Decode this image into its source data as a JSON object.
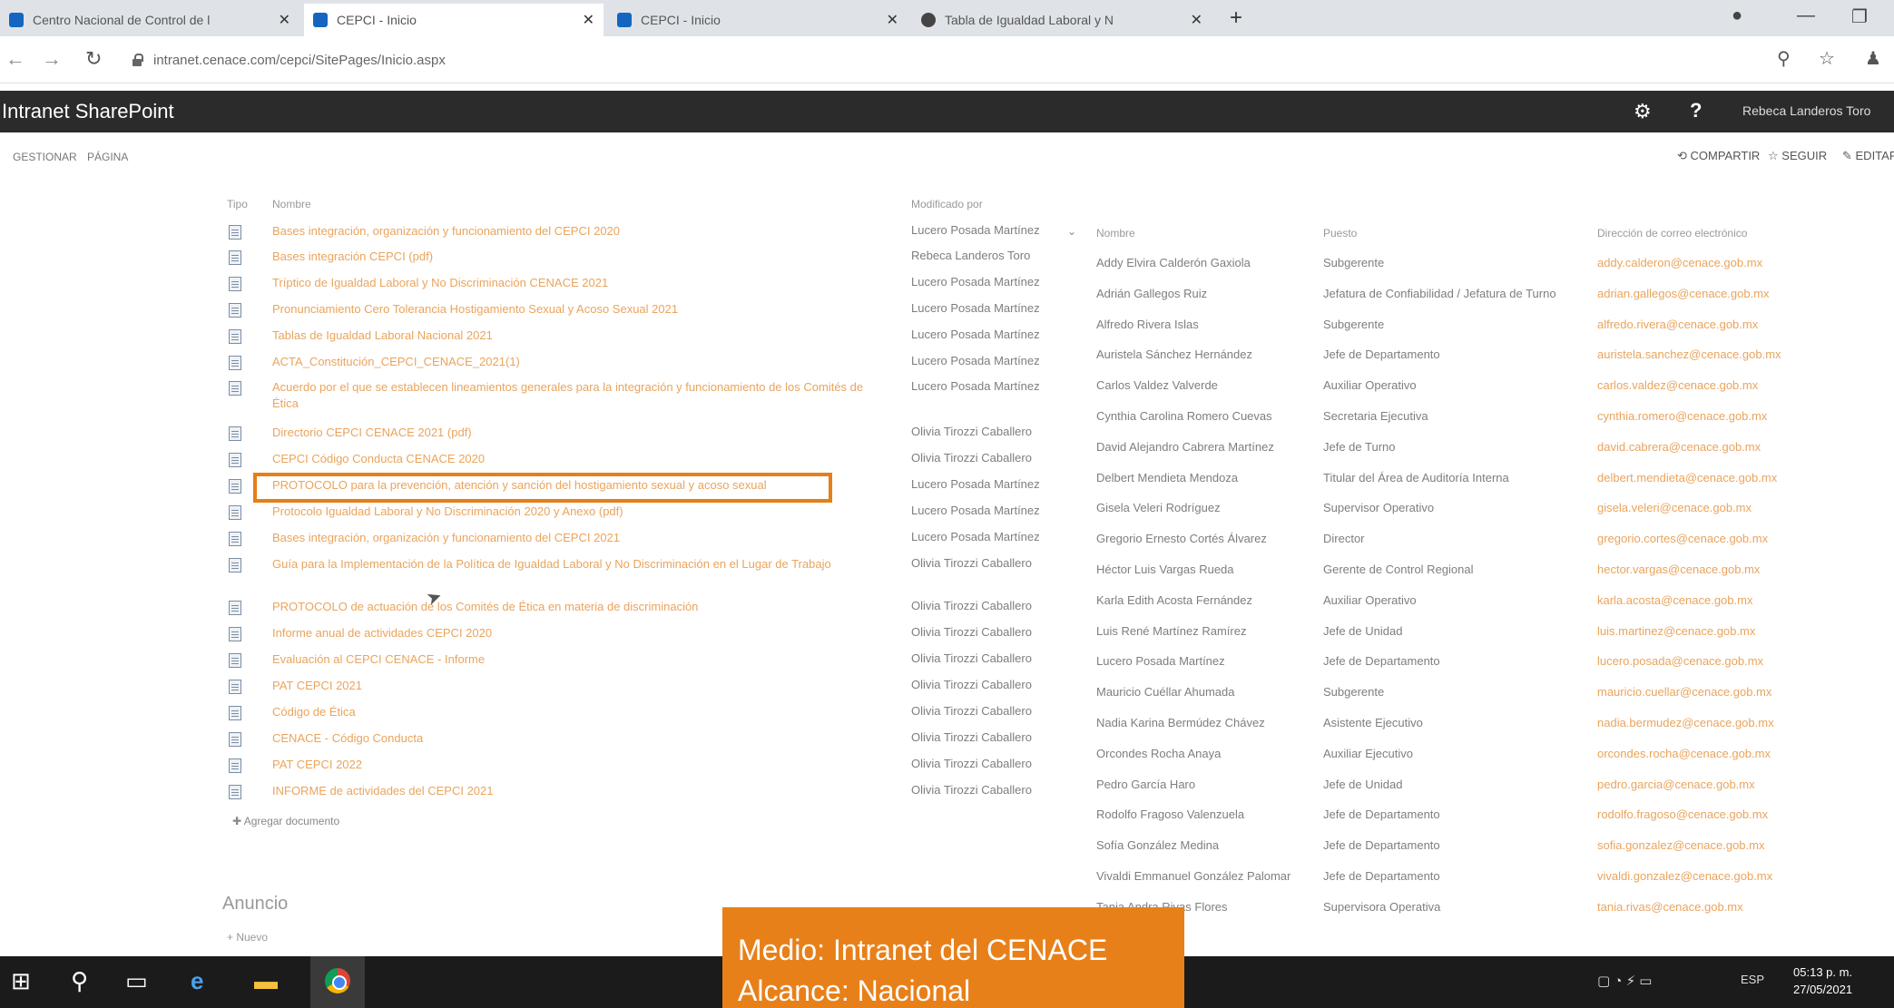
{
  "browser": {
    "tabs": [
      {
        "label": "Centro Nacional de Control de l",
        "active": false
      },
      {
        "label": "CEPCI - Inicio",
        "active": true
      },
      {
        "label": "CEPCI - Inicio",
        "active": false
      },
      {
        "label": "Tabla de Igualdad Laboral y N",
        "active": false
      }
    ],
    "new_tab": "+",
    "url": "intranet.cenace.com/cepci/SitePages/Inicio.aspx",
    "icons": {
      "back": "back-arrow-icon",
      "forward": "forward-arrow-icon",
      "reload": "reload-icon",
      "zoom": "zoom-icon",
      "star": "star-icon",
      "account": "account-icon"
    }
  },
  "suite": {
    "brand": "Intranet SharePoint",
    "help": "?",
    "user": "Rebeca Landeros Toro"
  },
  "ribbon": {
    "tabs": [
      "GESTIONAR",
      "PÁGINA"
    ],
    "actions": [
      "COMPARTIR",
      "SEGUIR",
      "EDITAR"
    ]
  },
  "documents": {
    "col_type": "Tipo",
    "col_name": "Nombre",
    "col_modified": "Modificado por",
    "add_link": "Agregar documento",
    "rows": [
      {
        "name": "Bases integración, organización y funcionamiento del CEPCI 2020",
        "modified_by": "Lucero Posada Martínez"
      },
      {
        "name": "Bases integración CEPCI (pdf)",
        "modified_by": "Rebeca Landeros Toro"
      },
      {
        "name": "Tríptico de Igualdad Laboral y No Discriminación CENACE 2021",
        "modified_by": "Lucero Posada Martínez"
      },
      {
        "name": "Pronunciamiento Cero Tolerancia Hostigamiento Sexual y Acoso Sexual 2021",
        "modified_by": "Lucero Posada Martínez"
      },
      {
        "name": "Tablas de Igualdad Laboral Nacional 2021",
        "modified_by": "Lucero Posada Martínez"
      },
      {
        "name": "ACTA_Constitución_CEPCI_CENACE_2021(1)",
        "modified_by": "Lucero Posada Martínez"
      },
      {
        "name": "Acuerdo por el que se establecen lineamientos generales para la integración y funcionamiento de los Comités de Ética",
        "modified_by": "Lucero Posada Martínez"
      },
      {
        "name": "Directorio CEPCI CENACE 2021 (pdf)",
        "modified_by": "Olivia Tirozzi Caballero"
      },
      {
        "name": "CEPCI Código Conducta CENACE 2020",
        "modified_by": "Olivia Tirozzi Caballero"
      },
      {
        "name": "PROTOCOLO para la prevención, atención y sanción del hostigamiento sexual y acoso sexual",
        "modified_by": "Lucero Posada Martínez"
      },
      {
        "name": "Protocolo Igualdad Laboral y No Discriminación 2020 y Anexo (pdf)",
        "modified_by": "Lucero Posada Martínez"
      },
      {
        "name": "Bases integración, organización y funcionamiento del CEPCI 2021",
        "modified_by": "Lucero Posada Martínez"
      },
      {
        "name": "Guía para la Implementación de la Política de Igualdad Laboral y No Discriminación en el Lugar de Trabajo",
        "modified_by": "Olivia Tirozzi Caballero"
      },
      {
        "name": "PROTOCOLO de actuación de los Comités de Ética en materia de discriminación",
        "modified_by": "Olivia Tirozzi Caballero"
      },
      {
        "name": "Informe anual de actividades CEPCI 2020",
        "modified_by": "Olivia Tirozzi Caballero"
      },
      {
        "name": "Evaluación al CEPCI CENACE - Informe",
        "modified_by": "Olivia Tirozzi Caballero"
      },
      {
        "name": "PAT CEPCI 2021",
        "modified_by": "Olivia Tirozzi Caballero"
      },
      {
        "name": "Código de Ética",
        "modified_by": "Olivia Tirozzi Caballero"
      },
      {
        "name": "CENACE - Código Conducta",
        "modified_by": "Olivia Tirozzi Caballero"
      },
      {
        "name": "PAT CEPCI 2022",
        "modified_by": "Olivia Tirozzi Caballero"
      },
      {
        "name": "INFORME de actividades del CEPCI 2021",
        "modified_by": "Olivia Tirozzi Caballero"
      }
    ]
  },
  "staff": {
    "col_name": "Nombre",
    "col_role": "Puesto",
    "col_mail": "Dirección de correo electrónico",
    "rows": [
      {
        "name": "Addy Elvira Calderón Gaxiola",
        "role": "Subgerente",
        "mail": "addy.calderon@cenace.gob.mx"
      },
      {
        "name": "Adrián Gallegos Ruiz",
        "role": "Jefatura de Confiabilidad / Jefatura de Turno",
        "mail": "adrian.gallegos@cenace.gob.mx"
      },
      {
        "name": "Alfredo Rivera Islas",
        "role": "Subgerente",
        "mail": "alfredo.rivera@cenace.gob.mx"
      },
      {
        "name": "Auristela Sánchez Hernández",
        "role": "Jefe de Departamento",
        "mail": "auristela.sanchez@cenace.gob.mx"
      },
      {
        "name": "Carlos Valdez Valverde",
        "role": "Auxiliar Operativo",
        "mail": "carlos.valdez@cenace.gob.mx"
      },
      {
        "name": "Cynthia Carolina Romero Cuevas",
        "role": "Secretaria Ejecutiva",
        "mail": "cynthia.romero@cenace.gob.mx"
      },
      {
        "name": "David Alejandro Cabrera Martínez",
        "role": "Jefe de Turno",
        "mail": "david.cabrera@cenace.gob.mx"
      },
      {
        "name": "Delbert Mendieta Mendoza",
        "role": "Titular del Área de Auditoría Interna",
        "mail": "delbert.mendieta@cenace.gob.mx"
      },
      {
        "name": "Gisela Veleri Rodríguez",
        "role": "Supervisor Operativo",
        "mail": "gisela.veleri@cenace.gob.mx"
      },
      {
        "name": "Gregorio Ernesto Cortés Álvarez",
        "role": "Director",
        "mail": "gregorio.cortes@cenace.gob.mx"
      },
      {
        "name": "Héctor Luis Vargas Rueda",
        "role": "Gerente de Control Regional",
        "mail": "hector.vargas@cenace.gob.mx"
      },
      {
        "name": "Karla Edith Acosta Fernández",
        "role": "Auxiliar Operativo",
        "mail": "karla.acosta@cenace.gob.mx"
      },
      {
        "name": "Luis René Martínez Ramírez",
        "role": "Jefe de Unidad",
        "mail": "luis.martinez@cenace.gob.mx"
      },
      {
        "name": "Lucero Posada Martínez",
        "role": "Jefe de Departamento",
        "mail": "lucero.posada@cenace.gob.mx"
      },
      {
        "name": "Mauricio Cuéllar Ahumada",
        "role": "Subgerente",
        "mail": "mauricio.cuellar@cenace.gob.mx"
      },
      {
        "name": "Nadia Karina Bermúdez Chávez",
        "role": "Asistente Ejecutivo",
        "mail": "nadia.bermudez@cenace.gob.mx"
      },
      {
        "name": "Orcondes Rocha Anaya",
        "role": "Auxiliar Ejecutivo",
        "mail": "orcondes.rocha@cenace.gob.mx"
      },
      {
        "name": "Pedro García Haro",
        "role": "Jefe de Unidad",
        "mail": "pedro.garcia@cenace.gob.mx"
      },
      {
        "name": "Rodolfo Fragoso Valenzuela",
        "role": "Jefe de Departamento",
        "mail": "rodolfo.fragoso@cenace.gob.mx"
      },
      {
        "name": "Sofía González Medina",
        "role": "Jefe de Departamento",
        "mail": "sofia.gonzalez@cenace.gob.mx"
      },
      {
        "name": "Vivaldi Emmanuel González Palomar",
        "role": "Jefe de Departamento",
        "mail": "vivaldi.gonzalez@cenace.gob.mx"
      },
      {
        "name": "Tania Andra Rivas Flores",
        "role": "Supervisora Operativa",
        "mail": "tania.rivas@cenace.gob.mx"
      }
    ]
  },
  "announcements": {
    "title": "Anuncio",
    "sub": "Nuevo"
  },
  "taskbar": {
    "lang": "ESP",
    "time": "05:13 p. m.",
    "date": "27/05/2021"
  },
  "caption": {
    "line1": "Medio: Intranet del CENACE",
    "line2": "Alcance: Nacional"
  },
  "colors": {
    "link": "#eaa45c",
    "highlight": "#e57f17",
    "caption_bg": "#e8801a",
    "suitebar": "#2b2b2b"
  }
}
